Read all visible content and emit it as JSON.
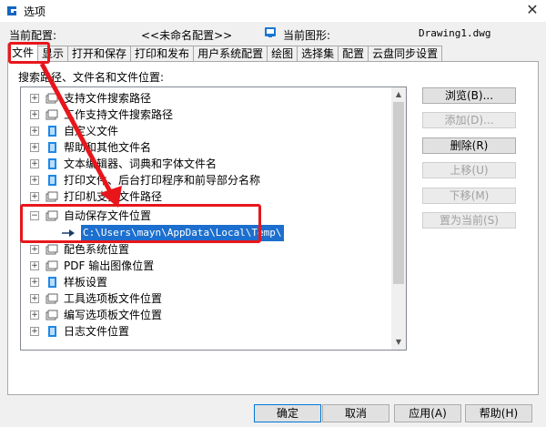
{
  "window": {
    "title": "选项",
    "close_glyph": "✕",
    "accent_color": "#e8161b",
    "selection_color": "#1c6fce"
  },
  "header": {
    "current_config_label": "当前配置:",
    "current_config_value": "<<未命名配置>>",
    "current_drawing_label": "当前图形:",
    "current_drawing_value": "Drawing1.dwg"
  },
  "tabs": [
    {
      "label": "文件",
      "active": true
    },
    {
      "label": "显示"
    },
    {
      "label": "打开和保存"
    },
    {
      "label": "打印和发布"
    },
    {
      "label": "用户系统配置"
    },
    {
      "label": "绘图"
    },
    {
      "label": "选择集"
    },
    {
      "label": "配置"
    },
    {
      "label": "云盘同步设置"
    }
  ],
  "panel": {
    "label": "搜索路径、文件名和文件位置:"
  },
  "tree": {
    "items": [
      {
        "label": "支持文件搜索路径",
        "icon": "folders-icon"
      },
      {
        "label": "工作支持文件搜索路径",
        "icon": "folders-icon"
      },
      {
        "label": "自定义文件",
        "icon": "file-icon"
      },
      {
        "label": "帮助和其他文件名",
        "icon": "file-icon"
      },
      {
        "label": "文本编辑器、词典和字体文件名",
        "icon": "file-icon"
      },
      {
        "label": "打印文件、后台打印程序和前导部分名称",
        "icon": "file-icon"
      },
      {
        "label": "打印机支持文件路径",
        "icon": "folders-icon"
      },
      {
        "label": "自动保存文件位置",
        "icon": "folders-icon",
        "expanded": true
      },
      {
        "label": "配色系统位置",
        "icon": "folders-icon"
      },
      {
        "label": "PDF 输出图像位置",
        "icon": "folders-icon"
      },
      {
        "label": "样板设置",
        "icon": "file-icon"
      },
      {
        "label": "工具选项板文件位置",
        "icon": "folders-icon"
      },
      {
        "label": "编写选项板文件位置",
        "icon": "folders-icon"
      },
      {
        "label": "日志文件位置",
        "icon": "file-icon"
      }
    ],
    "selected_path": "C:\\Users\\mayn\\AppData\\Local\\Temp\\"
  },
  "side_buttons": {
    "browse": "浏览(B)...",
    "add": "添加(D)...",
    "remove": "删除(R)",
    "move_up": "上移(U)",
    "move_down": "下移(M)",
    "set_current": "置为当前(S)"
  },
  "bottom_buttons": {
    "ok": "确定",
    "cancel": "取消",
    "apply": "应用(A)",
    "help": "帮助(H)"
  }
}
